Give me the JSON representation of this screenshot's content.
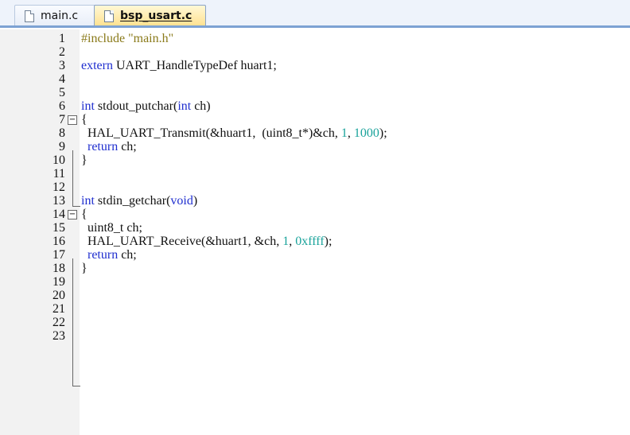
{
  "tabs": [
    {
      "label": "main.c",
      "active": false
    },
    {
      "label": "bsp_usart.c",
      "active": true
    }
  ],
  "lines": [
    {
      "n": "1",
      "tokens": [
        {
          "t": "#include ",
          "c": "pp"
        },
        {
          "t": "\"main.h\"",
          "c": "str"
        }
      ]
    },
    {
      "n": "2",
      "tokens": []
    },
    {
      "n": "3",
      "tokens": [
        {
          "t": "extern ",
          "c": "kw"
        },
        {
          "t": "UART_HandleTypeDef huart1;",
          "c": ""
        }
      ]
    },
    {
      "n": "4",
      "tokens": []
    },
    {
      "n": "5",
      "tokens": []
    },
    {
      "n": "6",
      "tokens": [
        {
          "t": "int ",
          "c": "kw"
        },
        {
          "t": "stdout_putchar(",
          "c": ""
        },
        {
          "t": "int ",
          "c": "kw"
        },
        {
          "t": "ch)",
          "c": ""
        }
      ]
    },
    {
      "n": "7",
      "fold": "⊟",
      "tokens": [
        {
          "t": "{",
          "c": ""
        }
      ]
    },
    {
      "n": "8",
      "tokens": [
        {
          "t": "  HAL_UART_Transmit(&huart1,  (uint8_t*)&ch, ",
          "c": ""
        },
        {
          "t": "1",
          "c": "num"
        },
        {
          "t": ", ",
          "c": ""
        },
        {
          "t": "1000",
          "c": "num"
        },
        {
          "t": ");",
          "c": ""
        }
      ]
    },
    {
      "n": "9",
      "tokens": [
        {
          "t": "  ",
          "c": ""
        },
        {
          "t": "return ",
          "c": "kw"
        },
        {
          "t": "ch;",
          "c": ""
        }
      ]
    },
    {
      "n": "10",
      "tokens": [
        {
          "t": "}",
          "c": ""
        }
      ]
    },
    {
      "n": "11",
      "tokens": []
    },
    {
      "n": "12",
      "tokens": []
    },
    {
      "n": "13",
      "tokens": [
        {
          "t": "int ",
          "c": "kw"
        },
        {
          "t": "stdin_getchar(",
          "c": ""
        },
        {
          "t": "void",
          "c": "kw"
        },
        {
          "t": ")",
          "c": ""
        }
      ]
    },
    {
      "n": "14",
      "fold": "⊟",
      "tokens": [
        {
          "t": "{",
          "c": ""
        }
      ]
    },
    {
      "n": "15",
      "tokens": [
        {
          "t": "  uint8_t ch;",
          "c": ""
        }
      ]
    },
    {
      "n": "16",
      "tokens": [
        {
          "t": "  HAL_UART_Receive(&huart1, &ch, ",
          "c": ""
        },
        {
          "t": "1",
          "c": "num"
        },
        {
          "t": ", ",
          "c": ""
        },
        {
          "t": "0xffff",
          "c": "num"
        },
        {
          "t": ");",
          "c": ""
        }
      ]
    },
    {
      "n": "17",
      "tokens": [
        {
          "t": "  ",
          "c": ""
        },
        {
          "t": "return ",
          "c": "kw"
        },
        {
          "t": "ch;",
          "c": ""
        }
      ]
    },
    {
      "n": "18",
      "tokens": [
        {
          "t": "}",
          "c": ""
        }
      ]
    },
    {
      "n": "19",
      "tokens": []
    },
    {
      "n": "20",
      "tokens": []
    },
    {
      "n": "21",
      "tokens": []
    },
    {
      "n": "22",
      "tokens": []
    },
    {
      "n": "23",
      "tokens": []
    }
  ],
  "colors": {
    "keyword": "#1f2ecf",
    "preprocessor": "#8a7a1a",
    "number": "#1aa39b",
    "active_tab": "#ffe18f"
  }
}
